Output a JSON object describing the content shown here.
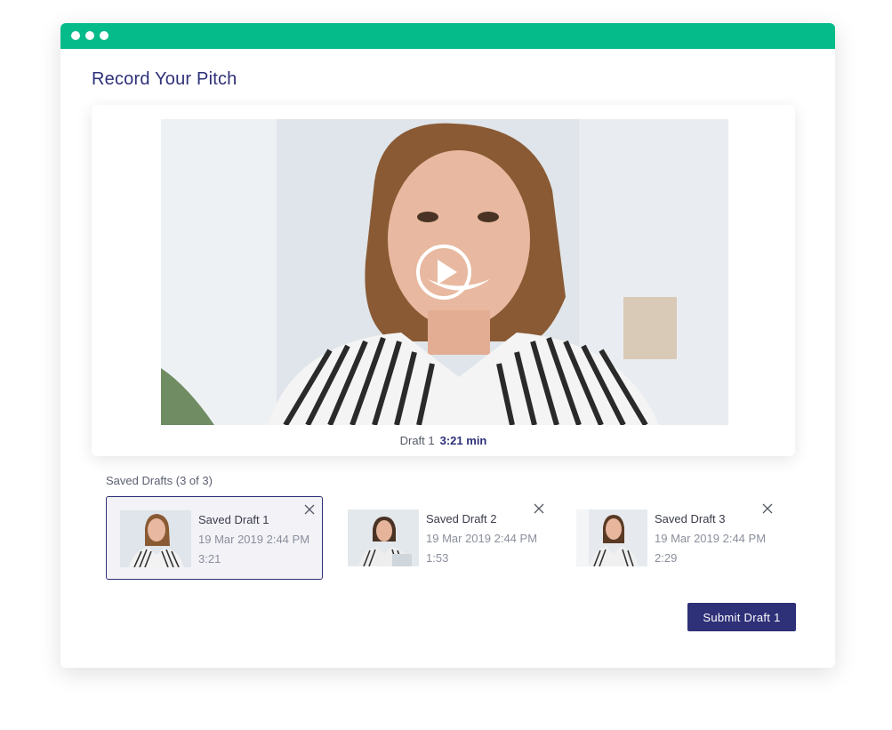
{
  "window": {
    "titlebar_color": "#05bb8a",
    "controls": [
      "dot",
      "dot",
      "dot"
    ]
  },
  "page": {
    "title": "Record Your Pitch"
  },
  "player": {
    "draft_label": "Draft 1",
    "duration": "3:21 min",
    "play_icon": "play-circle-icon"
  },
  "drafts": {
    "heading": "Saved Drafts (3 of 3)",
    "items": [
      {
        "name": "Saved Draft 1",
        "date": "19 Mar 2019 2:44 PM",
        "duration": "3:21",
        "selected": true
      },
      {
        "name": "Saved Draft 2",
        "date": "19 Mar 2019 2:44 PM",
        "duration": "1:53",
        "selected": false
      },
      {
        "name": "Saved Draft 3",
        "date": "19 Mar 2019 2:44 PM",
        "duration": "2:29",
        "selected": false
      }
    ]
  },
  "actions": {
    "submit_label": "Submit Draft 1"
  },
  "colors": {
    "accent": "#2e3078",
    "titlebar": "#05bb8a"
  }
}
